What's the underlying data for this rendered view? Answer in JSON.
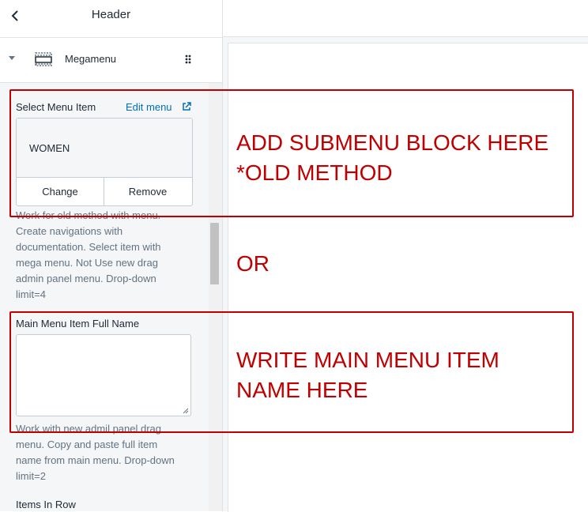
{
  "sidebar": {
    "header_title": "Header",
    "section": {
      "label": "Megamenu"
    },
    "fields": {
      "select_menu_item": {
        "label": "Select Menu Item",
        "edit_link": "Edit menu",
        "current_value": "WOMEN",
        "change_label": "Change",
        "remove_label": "Remove",
        "help_lines": [
          "Work for old method with menu.",
          "Create navigations with",
          "documentation. Select item with",
          "mega menu. Not Use new drag",
          "admin panel menu. Drop-down",
          "limit=4"
        ]
      },
      "main_menu_item_full_name": {
        "label": "Main Menu Item Full Name",
        "value": "",
        "help_lines": [
          "Work with new admil panel drag",
          "menu. Copy and paste full item",
          "name from main menu. Drop-down",
          "limit=2"
        ]
      },
      "items_in_row": {
        "label": "Items In Row"
      }
    }
  },
  "annotations": {
    "top_line1": "ADD SUBMENU BLOCK HERE",
    "top_line2": "*OLD METHOD",
    "or_text": "OR",
    "bottom_line1": "WRITE MAIN MENU ITEM",
    "bottom_line2": "NAME HERE"
  },
  "icons": {
    "back": "chevron-left-icon",
    "collapse": "caret-down-icon",
    "section": "megamenu-layout-icon",
    "drag": "drag-handle-icon",
    "external": "external-link-icon"
  },
  "colors": {
    "annotation_red": "#c00000",
    "link_blue": "#006fbb",
    "help_gray": "#637381"
  }
}
